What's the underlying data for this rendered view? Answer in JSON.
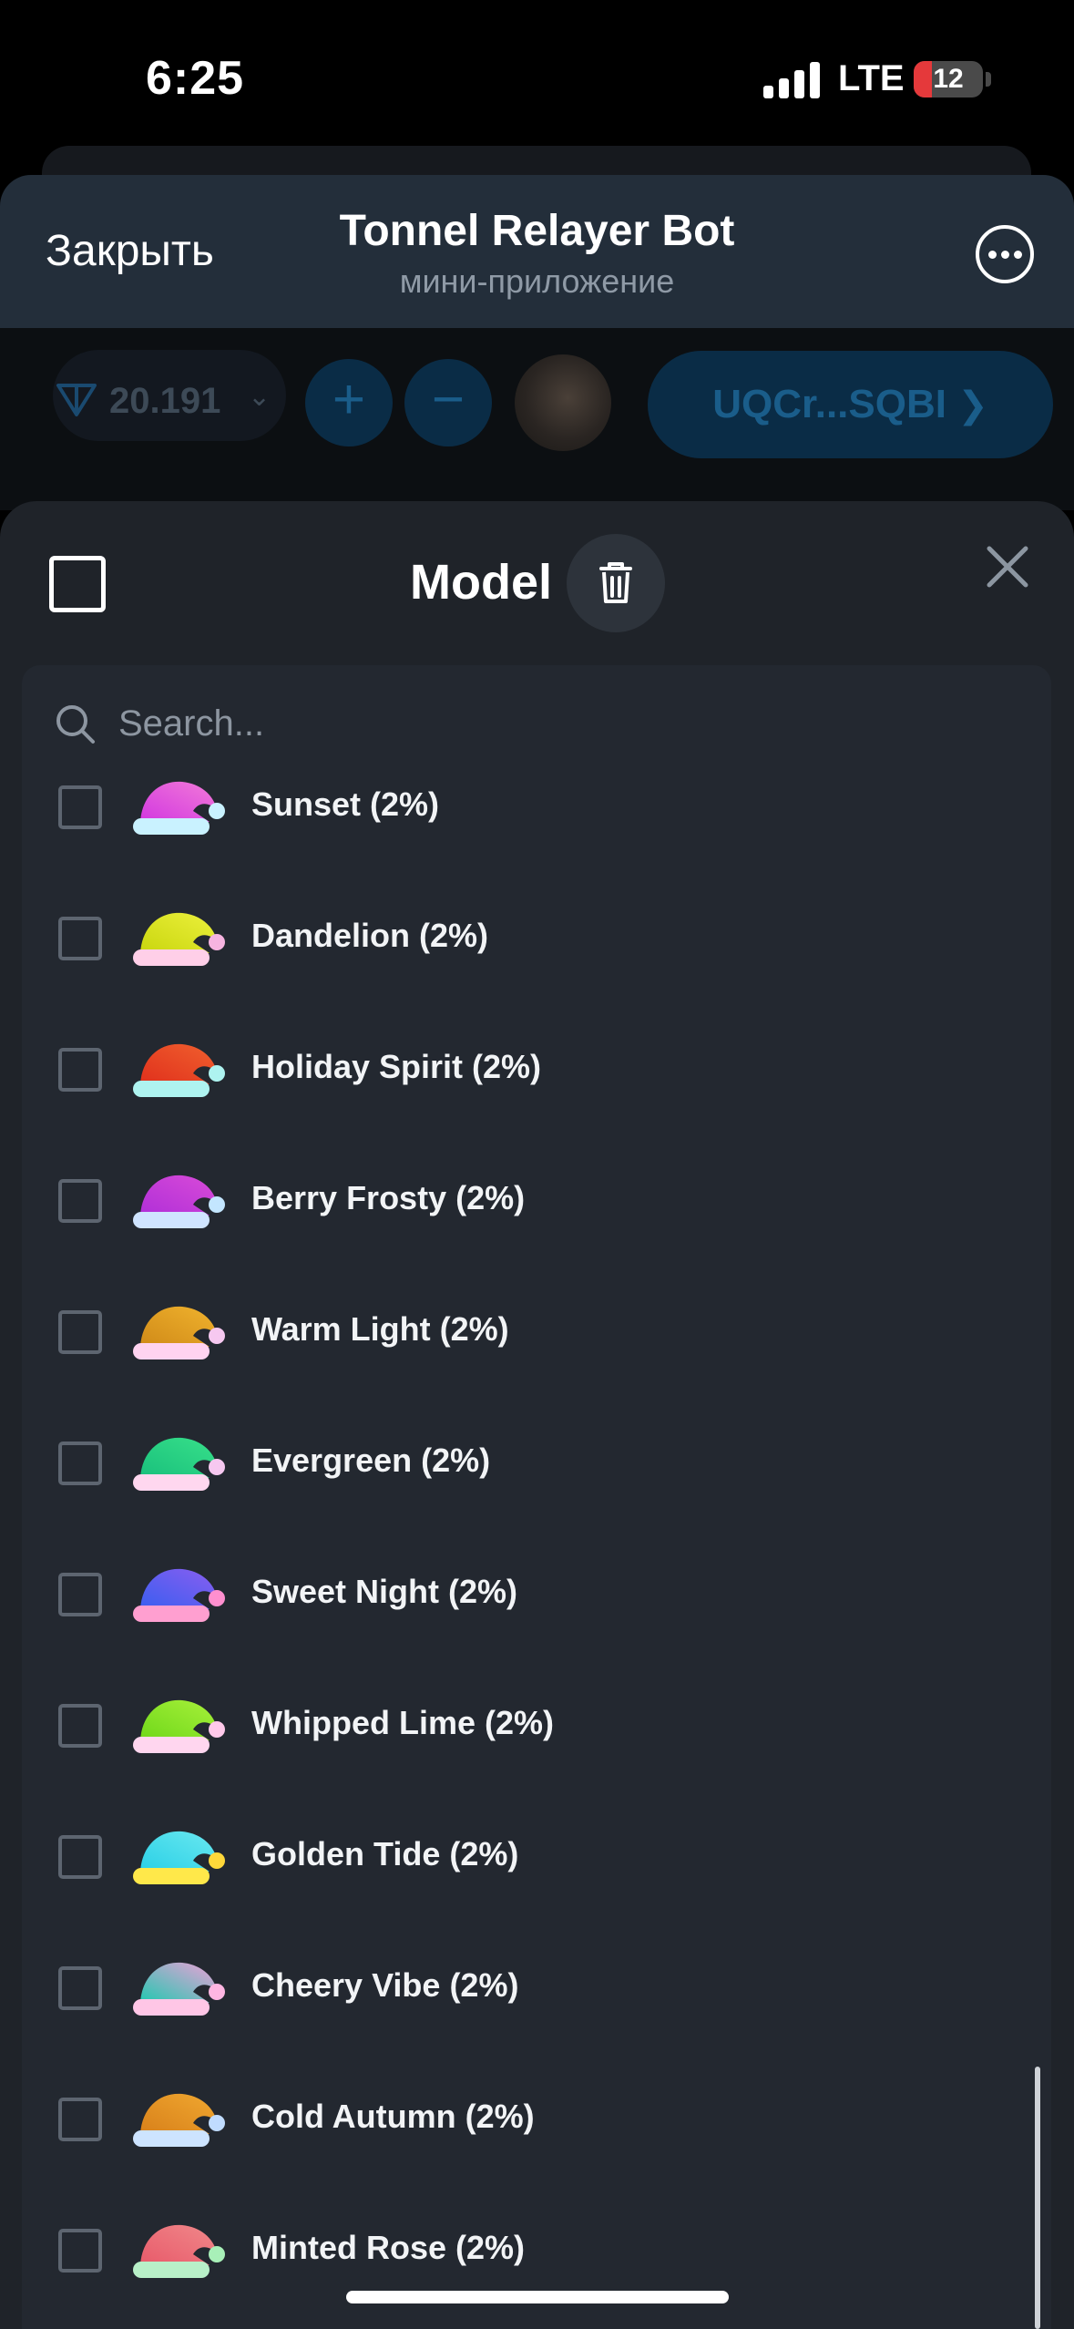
{
  "status_bar": {
    "time": "6:25",
    "network": "LTE",
    "battery": "12",
    "battery_level": 0.12,
    "battery_color": "#e5393b"
  },
  "telegram_header": {
    "close_label": "Закрыть",
    "title": "Tonnel Relayer Bot",
    "subtitle": "мини-приложение",
    "more_icon": "more-horizontal-circle-icon"
  },
  "app_bar": {
    "balance": "20.191",
    "plus_label": "+",
    "minus_label": "−",
    "wallet": "UQCr...SQBI"
  },
  "sheet": {
    "title": "Model",
    "search_placeholder": "Search...",
    "items": [
      {
        "label": "Sunset (2%)",
        "colors": [
          "#d238e0",
          "#f27ad8"
        ],
        "trim": "#c9f2ff",
        "pom": "#c9f2ff"
      },
      {
        "label": "Dandelion (2%)",
        "colors": [
          "#c9d60e",
          "#ecf03c"
        ],
        "trim": "#ffcfe8",
        "pom": "#f6b4e0"
      },
      {
        "label": "Holiday Spirit (2%)",
        "colors": [
          "#e0301c",
          "#f0602e"
        ],
        "trim": "#aef3f0",
        "pom": "#aef3f0"
      },
      {
        "label": "Berry Frosty (2%)",
        "colors": [
          "#b02fd8",
          "#d94bd8"
        ],
        "trim": "#cfe4ff",
        "pom": "#c3e6ff"
      },
      {
        "label": "Warm Light (2%)",
        "colors": [
          "#d08a18",
          "#f0b32e"
        ],
        "trim": "#ffd3f0",
        "pom": "#f6c8f0"
      },
      {
        "label": "Evergreen (2%)",
        "colors": [
          "#19c07c",
          "#38e08a"
        ],
        "trim": "#ffd7ef",
        "pom": "#f6c8f0"
      },
      {
        "label": "Sweet Night (2%)",
        "colors": [
          "#3a5ef0",
          "#8a5ef0"
        ],
        "trim": "#ff9fd0",
        "pom": "#ff8fcf"
      },
      {
        "label": "Whipped Lime (2%)",
        "colors": [
          "#6fd81a",
          "#a8f03a"
        ],
        "trim": "#ffd6ef",
        "pom": "#ffc9ea"
      },
      {
        "label": "Golden Tide (2%)",
        "colors": [
          "#2ad0e6",
          "#6ae8f0"
        ],
        "trim": "#ffe84a",
        "pom": "#ffd83a"
      },
      {
        "label": "Cheery Vibe (2%)",
        "colors": [
          "#20c8b0",
          "#f0a0d8"
        ],
        "trim": "#ffc6e6",
        "pom": "#ffb6e2"
      },
      {
        "label": "Cold Autumn (2%)",
        "colors": [
          "#d8801a",
          "#f0a830"
        ],
        "trim": "#cde4ff",
        "pom": "#c0dcff"
      },
      {
        "label": "Minted Rose (2%)",
        "colors": [
          "#e85a6a",
          "#f0888a"
        ],
        "trim": "#b8f0c8",
        "pom": "#a8f0b8"
      }
    ]
  }
}
